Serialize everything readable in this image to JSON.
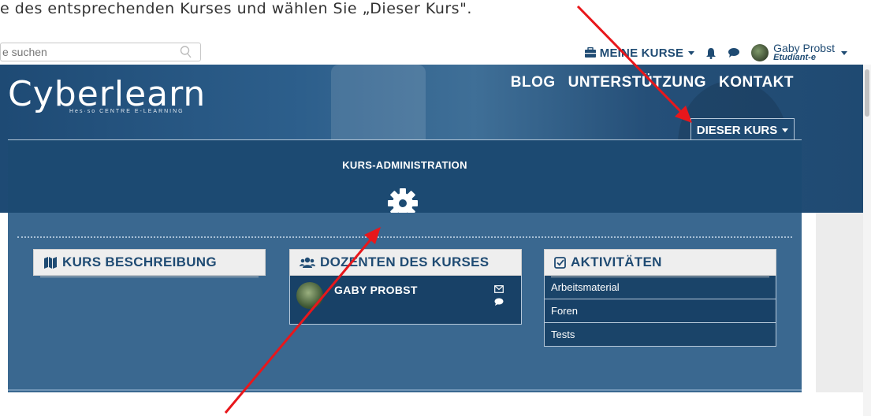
{
  "caption": "e des entsprechenden Kurses und wählen Sie „Dieser Kurs\".",
  "search": {
    "placeholder": "e suchen"
  },
  "topnav": {
    "my_courses": "MEINE KURSE",
    "user_name": "Gaby Probst",
    "user_role": "Etudiant-e"
  },
  "logo": {
    "name": "Cyberlearn",
    "subtitle": "Hes·so CENTRE E-LEARNING"
  },
  "mainnav": [
    "BLOG",
    "UNTERSTÜTZUNG",
    "KONTAKT"
  ],
  "dieser_kurs": "DIESER KURS",
  "admin": {
    "title": "KURS-ADMINISTRATION"
  },
  "cards": {
    "description": {
      "title": "KURS BESCHREIBUNG"
    },
    "teachers": {
      "title": "DOZENTEN DES KURSES",
      "teacher_name": "GABY PROBST"
    },
    "activities": {
      "title": "AKTIVITÄTEN",
      "items": [
        "Arbeitsmaterial",
        "Foren",
        "Tests"
      ]
    }
  },
  "colors": {
    "primary": "#1c4a72",
    "panel": "#3a6890",
    "arrow": "#e8171b"
  },
  "icons": [
    "search-icon",
    "briefcase-icon",
    "bell-icon",
    "chat-icon",
    "gear-icon",
    "map-icon",
    "users-icon",
    "checkbox-icon",
    "mail-icon"
  ]
}
